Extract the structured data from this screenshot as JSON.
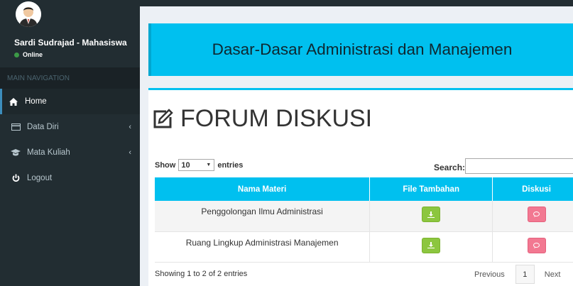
{
  "user": {
    "name": "Sardi Sudrajad - Mahasiswa",
    "status": "Online"
  },
  "sidebar": {
    "header": "MAIN NAVIGATION",
    "items": [
      {
        "label": "Home",
        "icon": "home-icon",
        "active": true
      },
      {
        "label": "Data Diri",
        "icon": "id-card-icon",
        "has_submenu": true
      },
      {
        "label": "Mata Kuliah",
        "icon": "graduation-cap-icon",
        "has_submenu": true
      },
      {
        "label": "Logout",
        "icon": "power-icon"
      }
    ]
  },
  "banner": {
    "title": "Dasar-Dasar Administrasi dan Manajemen"
  },
  "page": {
    "title": "FORUM DISKUSI"
  },
  "table_controls": {
    "show_label": "Show",
    "entries_value": "10",
    "entries_label": "entries",
    "search_label": "Search:",
    "search_value": ""
  },
  "table": {
    "headers": [
      "Nama Materi",
      "File Tambahan",
      "Diskusi"
    ],
    "rows": [
      {
        "nama": "Penggolongan Ilmu Administrasi"
      },
      {
        "nama": "Ruang Lingkup Administrasi Manajemen"
      }
    ]
  },
  "footer": {
    "info": "Showing 1 to 2 of 2 entries",
    "previous": "Previous",
    "page": "1",
    "next": "Next"
  },
  "colors": {
    "sidebar": "#222d32",
    "accent": "#00c0ef",
    "download_button": "#8cc63f",
    "discussion_button": "#f27891"
  }
}
